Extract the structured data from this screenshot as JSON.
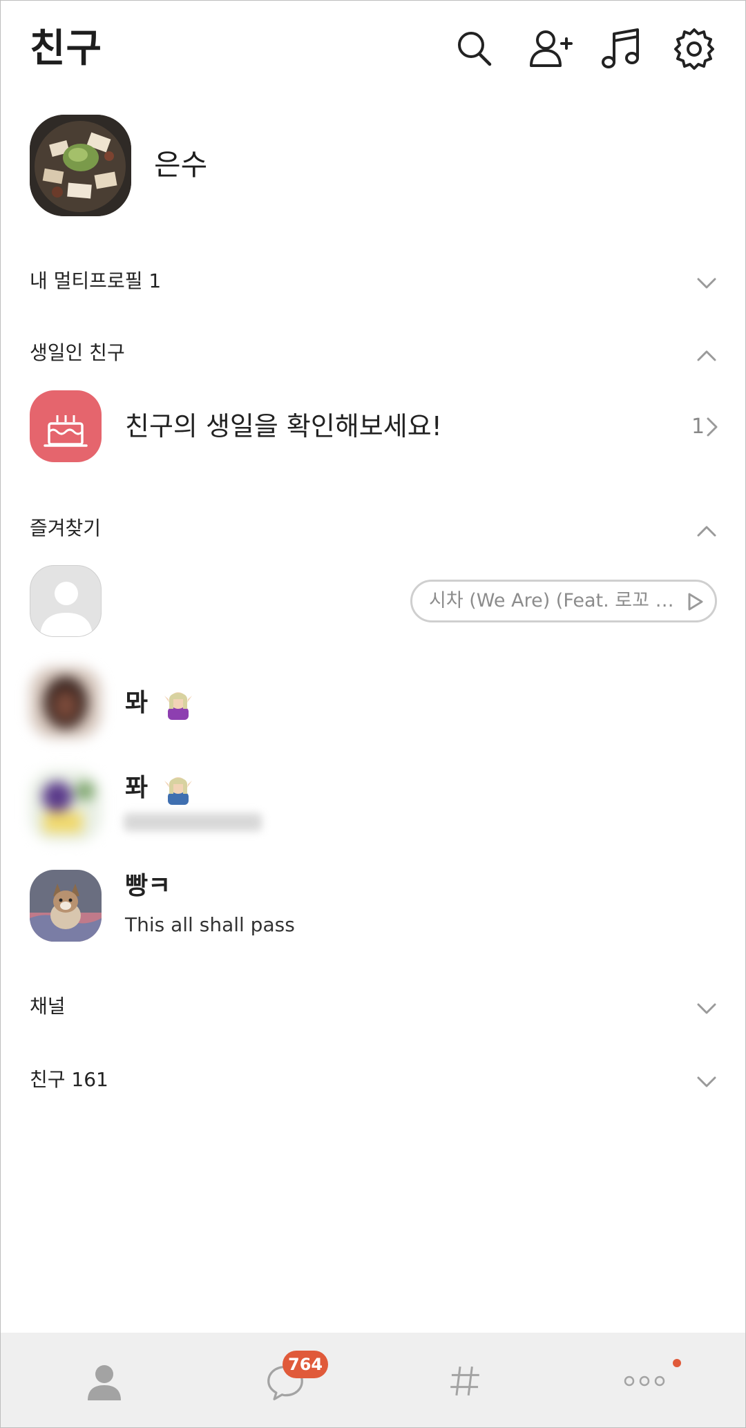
{
  "header": {
    "title": "친구",
    "icons": [
      "search-icon",
      "add-friend-icon",
      "music-icon",
      "settings-icon"
    ]
  },
  "my_profile": {
    "name": "은수"
  },
  "sections": {
    "multi_profile": "내 멀티프로필 1",
    "birthday": "생일인 친구",
    "favorites": "즐겨찾기",
    "channel": "채널",
    "friends": "친구 161"
  },
  "birthday_row": {
    "text": "친구의 생일을 확인해보세요!",
    "count": "1"
  },
  "favorites": {
    "music_pill": "시차 (We Are) (Feat. 로꼬 &...",
    "friends": [
      {
        "name": "뫄",
        "status": ""
      },
      {
        "name": "퐈",
        "status": ""
      },
      {
        "name": "빵ㅋ",
        "status": "This all shall pass"
      }
    ]
  },
  "bottom_nav": {
    "items": [
      "friends-tab",
      "chats-tab",
      "openchat-tab",
      "more-tab"
    ],
    "chat_badge": "764"
  },
  "colors": {
    "accent": "#e05a3a",
    "birthday": "#e5656d",
    "nav_bg": "#efefef"
  }
}
